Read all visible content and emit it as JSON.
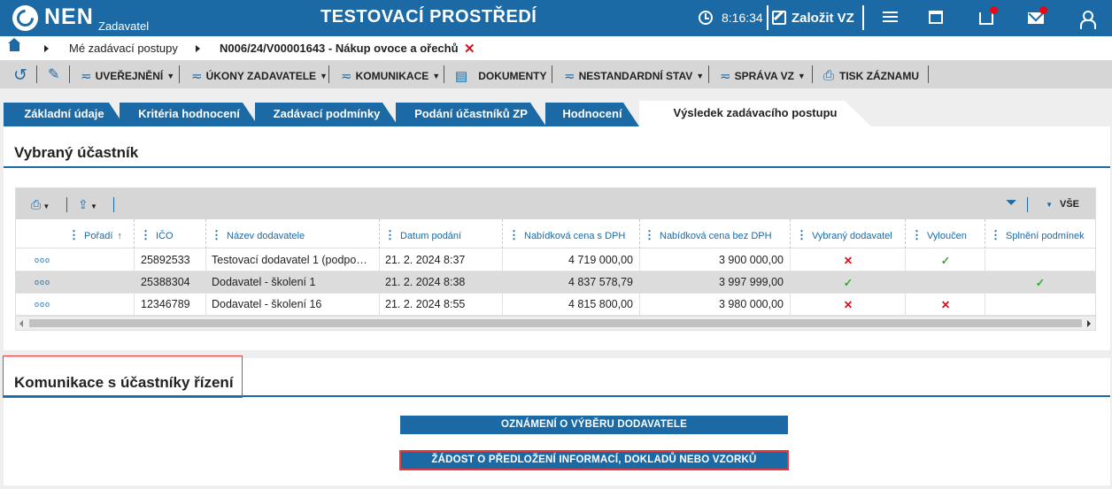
{
  "app": {
    "logo": "NEN",
    "logo_sub": "Zadavatel",
    "environment_title": "TESTOVACÍ PROSTŘEDÍ",
    "clock": "8:16:34",
    "create_label": "Založit VZ"
  },
  "breadcrumb": {
    "item1": "Mé zadávací postupy",
    "item2": "N006/24/V00001643 - Nákup ovoce a ořechů",
    "close": "✕"
  },
  "menu": {
    "uverejneni": "UVEŘEJNĚNÍ",
    "ukony": "ÚKONY ZADAVATELE",
    "komunikace": "KOMUNIKACE",
    "dokumenty": "DOKUMENTY",
    "nestandardni": "NESTANDARDNÍ STAV",
    "sprava": "SPRÁVA VZ",
    "tisk": "TISK ZÁZNAMU"
  },
  "tabs": [
    {
      "label": "Základní údaje"
    },
    {
      "label": "Kritéria hodnocení"
    },
    {
      "label": "Zadávací podmínky"
    },
    {
      "label": "Podání účastníků ZP"
    },
    {
      "label": "Hodnocení"
    },
    {
      "label": "Výsledek zadávacího postupu"
    }
  ],
  "section1": {
    "title": "Vybraný účastník"
  },
  "grid": {
    "filter_all": "VŠE",
    "columns": {
      "poradi": "Pořadí",
      "ico": "IČO",
      "nazev": "Název dodavatele",
      "datum": "Datum podání",
      "cena_s": "Nabídková cena s DPH",
      "cena_bez": "Nabídková cena bez DPH",
      "vybrany": "Vybraný dodavatel",
      "vyloucen": "Vyloučen",
      "splneni": "Splnění podmínek"
    },
    "rows": [
      {
        "menu": "ooo",
        "ico": "25892533",
        "nazev": "Testovací dodavatel 1 (podpo…",
        "datum": "21. 2. 2024 8:37",
        "cena_s": "4 719 000,00",
        "cena_bez": "3 900 000,00",
        "vybrany": "✕",
        "vyloucen": "✓",
        "splneni": ""
      },
      {
        "menu": "ooo",
        "ico": "25388304",
        "nazev": "Dodavatel - školení 1",
        "datum": "21. 2. 2024 8:38",
        "cena_s": "4 837 578,79",
        "cena_bez": "3 997 999,00",
        "vybrany": "✓",
        "vyloucen": "",
        "splneni": "✓"
      },
      {
        "menu": "ooo",
        "ico": "12346789",
        "nazev": "Dodavatel - školení 16",
        "datum": "21. 2. 2024 8:55",
        "cena_s": "4 815 800,00",
        "cena_bez": "3 980 000,00",
        "vybrany": "✕",
        "vyloucen": "✕",
        "splneni": ""
      }
    ]
  },
  "section2": {
    "title": "Komunikace s účastníky řízení",
    "button1": "OZNÁMENÍ O VÝBĚRU DODAVATELE",
    "button2": "ŽÁDOST O PŘEDLOŽENÍ INFORMACÍ, DOKLADŮ NEBO VZORKŮ"
  },
  "colors": {
    "brand": "#1b6aa5",
    "error": "#e30b17",
    "success": "#3aaa35"
  }
}
